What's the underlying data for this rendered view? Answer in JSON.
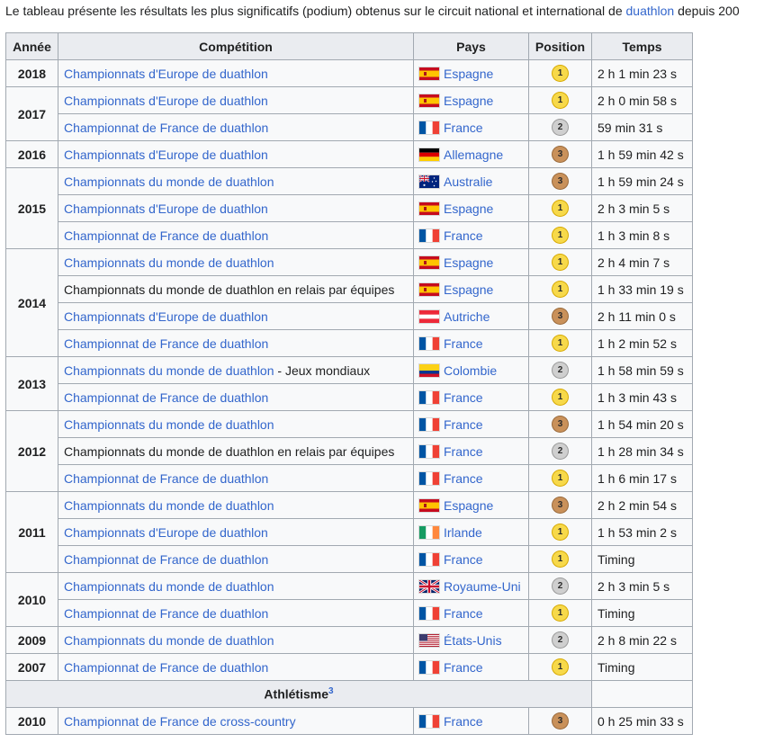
{
  "intro": {
    "before": "Le tableau présente les résultats les plus significatifs (podium) obtenus sur le circuit national et international de ",
    "link": "duathlon",
    "after": " depuis 200"
  },
  "table": {
    "headers": {
      "year": "Année",
      "competition": "Compétition",
      "country": "Pays",
      "position": "Position",
      "time": "Temps"
    },
    "groups": [
      {
        "year": "2018",
        "rows": [
          {
            "competition": "Championnats d'Europe de duathlon",
            "competition_suffix": "",
            "competition_linked": true,
            "country": "Espagne",
            "flag": "es",
            "position": "1",
            "time": "2 h 1 min 23 s"
          }
        ]
      },
      {
        "year": "2017",
        "rows": [
          {
            "competition": "Championnats d'Europe de duathlon",
            "competition_suffix": "",
            "competition_linked": true,
            "country": "Espagne",
            "flag": "es",
            "position": "1",
            "time": "2 h 0 min 58 s"
          },
          {
            "competition": "Championnat de France de duathlon",
            "competition_suffix": "",
            "competition_linked": true,
            "country": "France",
            "flag": "fr",
            "position": "2",
            "time": "59 min 31 s"
          }
        ]
      },
      {
        "year": "2016",
        "rows": [
          {
            "competition": "Championnats d'Europe de duathlon",
            "competition_suffix": "",
            "competition_linked": true,
            "country": "Allemagne",
            "flag": "de",
            "position": "3",
            "time": "1 h 59 min 42 s"
          }
        ]
      },
      {
        "year": "2015",
        "rows": [
          {
            "competition": "Championnats du monde de duathlon",
            "competition_suffix": "",
            "competition_linked": true,
            "country": "Australie",
            "flag": "au",
            "position": "3",
            "time": "1 h 59 min 24 s"
          },
          {
            "competition": "Championnats d'Europe de duathlon",
            "competition_suffix": "",
            "competition_linked": true,
            "country": "Espagne",
            "flag": "es",
            "position": "1",
            "time": "2 h 3 min 5 s"
          },
          {
            "competition": "Championnat de France de duathlon",
            "competition_suffix": "",
            "competition_linked": true,
            "country": "France",
            "flag": "fr",
            "position": "1",
            "time": "1 h 3 min 8 s"
          }
        ]
      },
      {
        "year": "2014",
        "rows": [
          {
            "competition": "Championnats du monde de duathlon",
            "competition_suffix": "",
            "competition_linked": true,
            "country": "Espagne",
            "flag": "es",
            "position": "1",
            "time": "2 h 4 min 7 s"
          },
          {
            "competition": "Championnats du monde de duathlon en relais par équipes",
            "competition_suffix": "",
            "competition_linked": false,
            "country": "Espagne",
            "flag": "es",
            "position": "1",
            "time": "1 h 33 min 19 s"
          },
          {
            "competition": "Championnats d'Europe de duathlon",
            "competition_suffix": "",
            "competition_linked": true,
            "country": "Autriche",
            "flag": "at",
            "position": "3",
            "time": "2 h 11 min 0 s"
          },
          {
            "competition": "Championnat de France de duathlon",
            "competition_suffix": "",
            "competition_linked": true,
            "country": "France",
            "flag": "fr",
            "position": "1",
            "time": "1 h 2 min 52 s"
          }
        ]
      },
      {
        "year": "2013",
        "rows": [
          {
            "competition": "Championnats du monde de duathlon",
            "competition_suffix": " - Jeux mondiaux",
            "competition_linked": true,
            "country": "Colombie",
            "flag": "co",
            "position": "2",
            "time": "1 h 58 min 59 s"
          },
          {
            "competition": "Championnat de France de duathlon",
            "competition_suffix": "",
            "competition_linked": true,
            "country": "France",
            "flag": "fr",
            "position": "1",
            "time": "1 h 3 min 43 s"
          }
        ]
      },
      {
        "year": "2012",
        "rows": [
          {
            "competition": "Championnats du monde de duathlon",
            "competition_suffix": "",
            "competition_linked": true,
            "country": "France",
            "flag": "fr",
            "position": "3",
            "time": "1 h 54 min 20 s"
          },
          {
            "competition": "Championnats du monde de duathlon en relais par équipes",
            "competition_suffix": "",
            "competition_linked": false,
            "country": "France",
            "flag": "fr",
            "position": "2",
            "time": "1 h 28 min 34 s"
          },
          {
            "competition": "Championnat de France de duathlon",
            "competition_suffix": "",
            "competition_linked": true,
            "country": "France",
            "flag": "fr",
            "position": "1",
            "time": "1 h 6 min 17 s"
          }
        ]
      },
      {
        "year": "2011",
        "rows": [
          {
            "competition": "Championnats du monde de duathlon",
            "competition_suffix": "",
            "competition_linked": true,
            "country": "Espagne",
            "flag": "es",
            "position": "3",
            "time": "2 h 2 min 54 s"
          },
          {
            "competition": "Championnats d'Europe de duathlon",
            "competition_suffix": "",
            "competition_linked": true,
            "country": "Irlande",
            "flag": "ie",
            "position": "1",
            "time": "1 h 53 min 2 s"
          },
          {
            "competition": "Championnat de France de duathlon",
            "competition_suffix": "",
            "competition_linked": true,
            "country": "France",
            "flag": "fr",
            "position": "1",
            "time": "Timing"
          }
        ]
      },
      {
        "year": "2010",
        "rows": [
          {
            "competition": "Championnats du monde de duathlon",
            "competition_suffix": "",
            "competition_linked": true,
            "country": "Royaume-Uni",
            "flag": "gb",
            "position": "2",
            "time": "2 h 3 min 5 s"
          },
          {
            "competition": "Championnat de France de duathlon",
            "competition_suffix": "",
            "competition_linked": true,
            "country": "France",
            "flag": "fr",
            "position": "1",
            "time": "Timing"
          }
        ]
      },
      {
        "year": "2009",
        "rows": [
          {
            "competition": "Championnats du monde de duathlon",
            "competition_suffix": "",
            "competition_linked": true,
            "country": "États-Unis",
            "flag": "us",
            "position": "2",
            "time": "2 h 8 min 22 s"
          }
        ]
      },
      {
        "year": "2007",
        "rows": [
          {
            "competition": "Championnat de France de duathlon",
            "competition_suffix": "",
            "competition_linked": true,
            "country": "France",
            "flag": "fr",
            "position": "1",
            "time": "Timing"
          }
        ]
      }
    ],
    "section": {
      "label": "Athlétisme",
      "note": "3"
    },
    "athletics_groups": [
      {
        "year": "2010",
        "rows": [
          {
            "competition": "Championnat de France de cross-country",
            "competition_suffix": "",
            "competition_linked": true,
            "country": "France",
            "flag": "fr",
            "position": "3",
            "time": "0 h 25 min 33 s"
          }
        ]
      }
    ]
  },
  "colors": {
    "link": "#3366cc",
    "header_bg": "#eaecf0",
    "cell_bg": "#f8f9fa",
    "border": "#a2a9b1",
    "gold": "#f7d94a",
    "silver": "#cfcfcf",
    "bronze": "#c9915a"
  }
}
